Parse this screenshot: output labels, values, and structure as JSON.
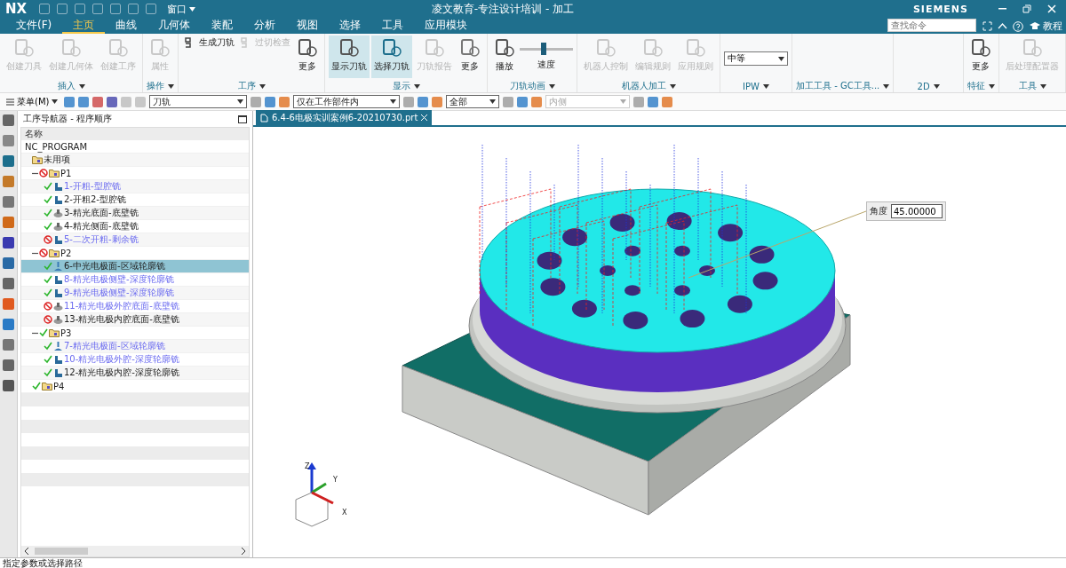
{
  "title_bar": {
    "logo": "NX",
    "window_menu": "窗口",
    "title": "凌文教育-专注设计培训 - 加工",
    "brand": "SIEMENS"
  },
  "menu_tabs": [
    {
      "label": "文件(F)",
      "selected": false
    },
    {
      "label": "主页",
      "selected": true
    },
    {
      "label": "曲线",
      "selected": false
    },
    {
      "label": "几何体",
      "selected": false
    },
    {
      "label": "装配",
      "selected": false
    },
    {
      "label": "分析",
      "selected": false
    },
    {
      "label": "视图",
      "selected": false
    },
    {
      "label": "选择",
      "selected": false
    },
    {
      "label": "工具",
      "selected": false
    },
    {
      "label": "应用模块",
      "selected": false
    }
  ],
  "search": {
    "placeholder": "查找命令"
  },
  "help": {
    "label": "教程"
  },
  "ribbon_groups": [
    {
      "label": "插入",
      "items": [
        {
          "kind": "large",
          "label": "创建刀具",
          "disabled": true
        },
        {
          "kind": "large",
          "label": "创建几何体",
          "disabled": true
        },
        {
          "kind": "large",
          "label": "创建工序",
          "disabled": true
        }
      ]
    },
    {
      "label": "操作",
      "items": [
        {
          "kind": "large",
          "label": "属性",
          "disabled": true
        }
      ]
    },
    {
      "label": "工序",
      "items": [
        {
          "kind": "small",
          "label": "生成刀轨",
          "disabled": false
        },
        {
          "kind": "small",
          "label": "过切检查",
          "disabled": true
        },
        {
          "kind": "large",
          "label": "更多",
          "disabled": false
        }
      ]
    },
    {
      "label": "显示",
      "items": [
        {
          "kind": "large",
          "label": "显示刀轨",
          "disabled": false,
          "selected": true
        },
        {
          "kind": "large",
          "label": "选择刀轨",
          "disabled": false,
          "selected": true
        },
        {
          "kind": "large",
          "label": "刀轨报告",
          "disabled": true,
          "selected": false
        },
        {
          "kind": "large",
          "label": "更多",
          "disabled": false,
          "selected": false
        }
      ]
    },
    {
      "label": "刀轨动画",
      "items": [
        {
          "kind": "large",
          "label": "播放",
          "disabled": false
        },
        {
          "kind": "slider",
          "label": "速度",
          "level": 0.45
        }
      ]
    },
    {
      "label": "机器人加工",
      "items": [
        {
          "kind": "large",
          "label": "机器人控制",
          "disabled": true
        },
        {
          "kind": "large",
          "label": "编辑规则",
          "disabled": true
        },
        {
          "kind": "large",
          "label": "应用规则",
          "disabled": true
        }
      ]
    },
    {
      "label": "IPW",
      "items": [
        {
          "kind": "select",
          "label": "中等"
        }
      ]
    },
    {
      "label": "加工工具 - GC工具..."
    },
    {
      "label": "2D"
    },
    {
      "label": "特征",
      "items": [
        {
          "kind": "large",
          "label": "更多",
          "disabled": false
        }
      ]
    },
    {
      "label": "工具",
      "items": [
        {
          "kind": "large",
          "label": "后处理配置器",
          "disabled": true
        }
      ]
    }
  ],
  "toolbar": {
    "menu": "菜单(M)",
    "filters": [
      {
        "value": "刀轨",
        "disabled": false
      },
      {
        "value": "仅在工作部件内",
        "disabled": false
      },
      {
        "value": "全部",
        "disabled": false
      },
      {
        "value": "内侧",
        "disabled": true
      }
    ]
  },
  "navigator": {
    "title": "工序导航器 - 程序顺序",
    "column": "名称",
    "tree": [
      {
        "label": "NC_PROGRAM",
        "children": [
          {
            "label": "未用项",
            "kind": "program"
          },
          {
            "label": "P1",
            "kind": "program",
            "complete": false,
            "expanded": true,
            "children": [
              {
                "label": "1-开粗-型腔铣",
                "kind": "cavity",
                "complete": true,
                "outdated": true,
                "selected": false
              },
              {
                "label": "2-开粗2-型腔铣",
                "kind": "cavity",
                "complete": true,
                "outdated": false,
                "selected": false
              },
              {
                "label": "3-精光底面-底壁铣",
                "kind": "floor",
                "complete": true,
                "outdated": false,
                "selected": false
              },
              {
                "label": "4-精光侧面-底壁铣",
                "kind": "floor",
                "complete": true,
                "outdated": false,
                "selected": false
              },
              {
                "label": "5-二次开粗-剩余铣",
                "kind": "cavity",
                "complete": false,
                "outdated": true,
                "selected": false
              }
            ]
          },
          {
            "label": "P2",
            "kind": "program",
            "complete": false,
            "expanded": true,
            "children": [
              {
                "label": "6-中光电极面-区域轮廓铣",
                "kind": "area",
                "complete": true,
                "outdated": false,
                "selected": true
              },
              {
                "label": "8-精光电极侧壁-深度轮廓铣",
                "kind": "cavity",
                "complete": true,
                "outdated": true,
                "selected": false
              },
              {
                "label": "9-精光电极侧壁-深度轮廓铣",
                "kind": "cavity",
                "complete": true,
                "outdated": true,
                "selected": false
              },
              {
                "label": "11-精光电极外腔底面-底壁铣",
                "kind": "floor",
                "complete": false,
                "outdated": true,
                "selected": false
              },
              {
                "label": "13-精光电极内腔底面-底壁铣",
                "kind": "floor",
                "complete": false,
                "outdated": false,
                "selected": false
              }
            ]
          },
          {
            "label": "P3",
            "kind": "program",
            "complete": true,
            "expanded": true,
            "children": [
              {
                "label": "7-精光电极面-区域轮廓铣",
                "kind": "area",
                "complete": true,
                "outdated": true,
                "selected": false
              },
              {
                "label": "10-精光电极外腔-深度轮廓铣",
                "kind": "cavity",
                "complete": true,
                "outdated": true,
                "selected": false
              },
              {
                "label": "12-精光电极内腔-深度轮廓铣",
                "kind": "cavity",
                "complete": true,
                "outdated": false,
                "selected": false
              }
            ]
          },
          {
            "label": "P4",
            "kind": "program",
            "complete": true
          }
        ]
      }
    ]
  },
  "document_tab": {
    "label": "6.4-6电极实训案例6-20210730.prt"
  },
  "angle_input": {
    "label": "角度",
    "value": "45.00000"
  },
  "axis_labels": [
    "Z",
    "Y",
    "X"
  ],
  "status_bar": {
    "message": "指定参数或选择路径"
  }
}
